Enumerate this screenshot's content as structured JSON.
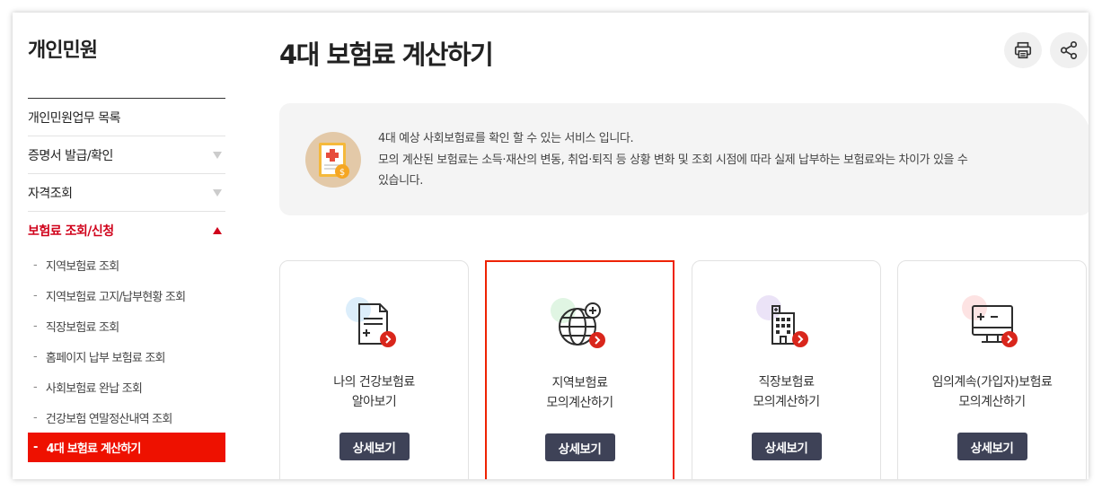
{
  "sidebar": {
    "title": "개인민원",
    "items": [
      {
        "label": "개인민원업무 목록",
        "arrow": "none"
      },
      {
        "label": "증명서 발급/확인",
        "arrow": "down"
      },
      {
        "label": "자격조회",
        "arrow": "down"
      },
      {
        "label": "보험료 조회/신청",
        "arrow": "up"
      }
    ],
    "sub_items": [
      {
        "label": "지역보험료 조회"
      },
      {
        "label": "지역보험료 고지/납부현황 조회"
      },
      {
        "label": "직장보험료 조회"
      },
      {
        "label": "홈페이지 납부 보험료 조회"
      },
      {
        "label": "사회보험료 완납 조회"
      },
      {
        "label": "건강보험 연말정산내역 조회"
      },
      {
        "label": "4대 보험료 계산하기"
      }
    ],
    "dash": "-"
  },
  "main": {
    "title": "4대 보험료 계산하기",
    "info_lines": [
      "4대 예상 사회보험료를 확인 할 수 있는 서비스 입니다.",
      "모의 계산된 보험료는 소득·재산의 변동, 취업·퇴직 등 상황 변화 및 조회 시점에 따라 실제 납부하는 보험료와는 차이가 있을 수",
      "있습니다."
    ],
    "cards": [
      {
        "line1": "나의 건강보험료",
        "line2": "알아보기",
        "button": "상세보기",
        "icon": "document-icon",
        "dot_color": "#dceefb"
      },
      {
        "line1": "지역보험료",
        "line2": "모의계산하기",
        "button": "상세보기",
        "icon": "globe-icon",
        "dot_color": "#e0f5e3"
      },
      {
        "line1": "직장보험료",
        "line2": "모의계산하기",
        "button": "상세보기",
        "icon": "building-icon",
        "dot_color": "#ebe3f7"
      },
      {
        "line1": "임의계속(가입자)보험료",
        "line2": "모의계산하기",
        "button": "상세보기",
        "icon": "calculator-monitor-icon",
        "dot_color": "#fde3e3"
      }
    ]
  },
  "colors": {
    "accent": "#d0021b",
    "button": "#3e4257",
    "active_bg": "#ee1100"
  }
}
